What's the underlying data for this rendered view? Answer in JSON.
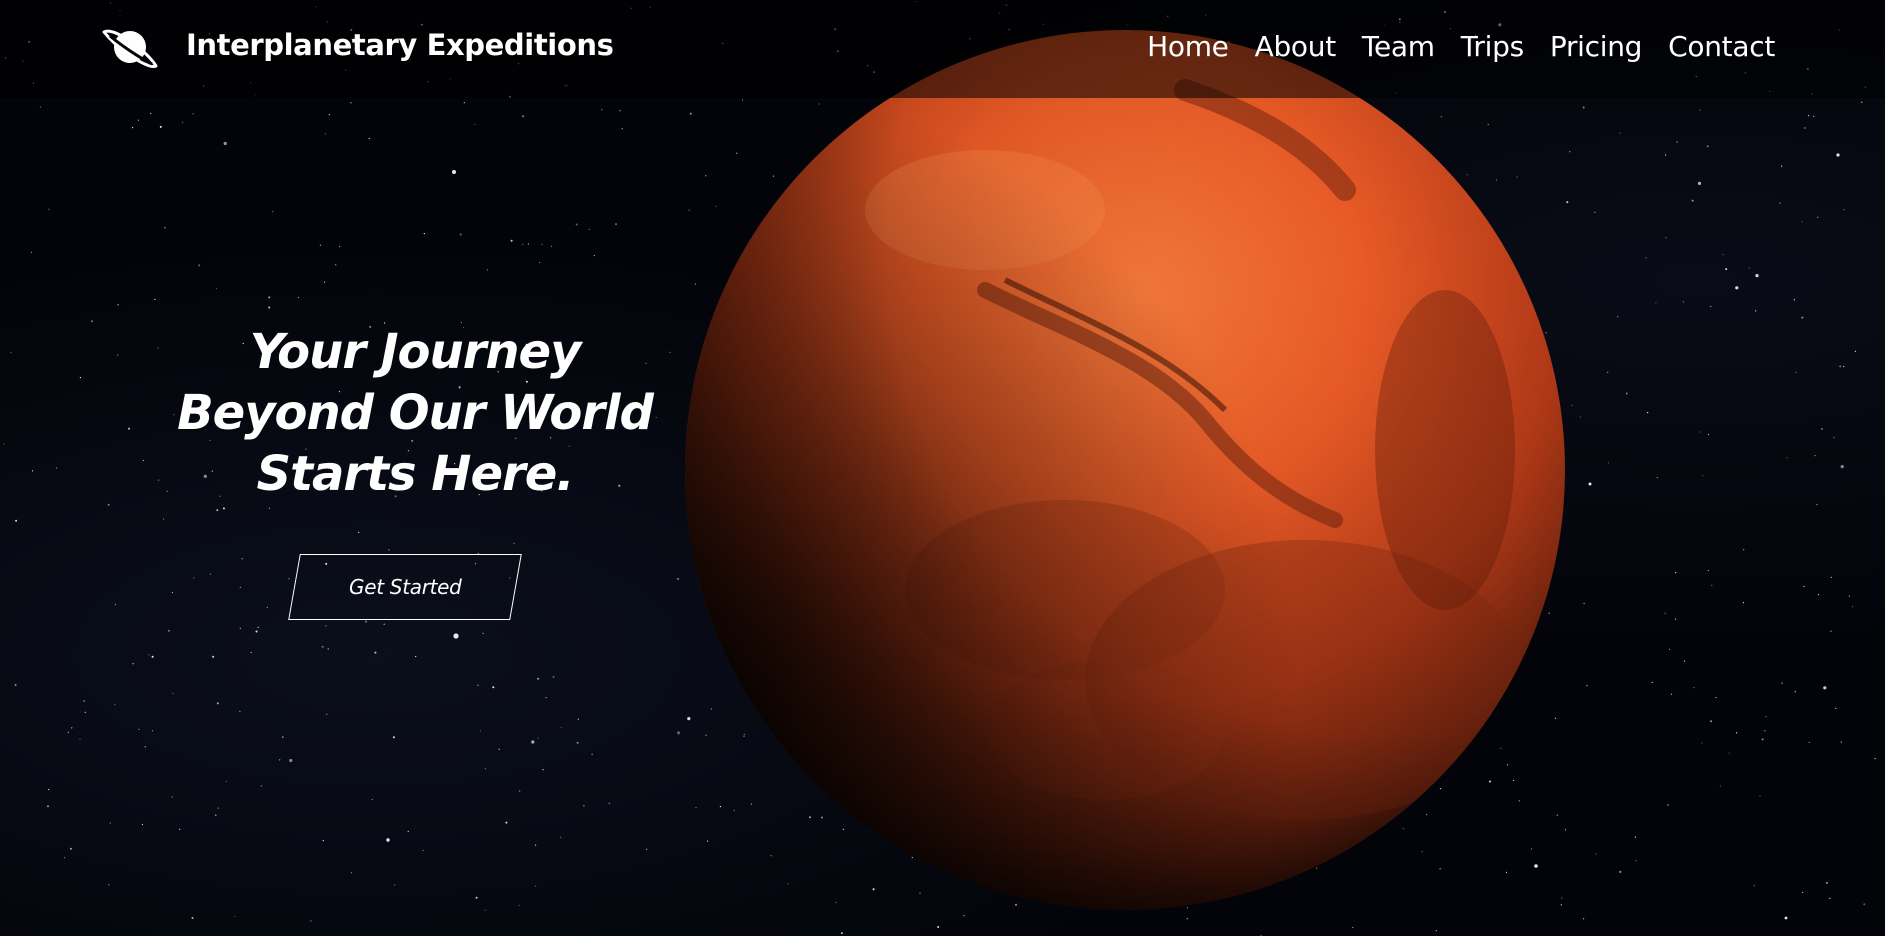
{
  "brand": {
    "name": "Interplanetary Expeditions",
    "logo_icon": "planet-ring-icon"
  },
  "nav": {
    "items": [
      {
        "label": "Home"
      },
      {
        "label": "About"
      },
      {
        "label": "Team"
      },
      {
        "label": "Trips"
      },
      {
        "label": "Pricing"
      },
      {
        "label": "Contact"
      }
    ]
  },
  "hero": {
    "title_lines": [
      "Your Journey",
      "Beyond Our World",
      "Starts Here."
    ],
    "cta_label": "Get Started",
    "background_image": "mars-planet-in-starfield"
  },
  "colors": {
    "background": "#03040a",
    "text": "#ffffff",
    "planet": "#d4441c",
    "nav_overlay": "rgba(0,0,0,0.55)"
  }
}
